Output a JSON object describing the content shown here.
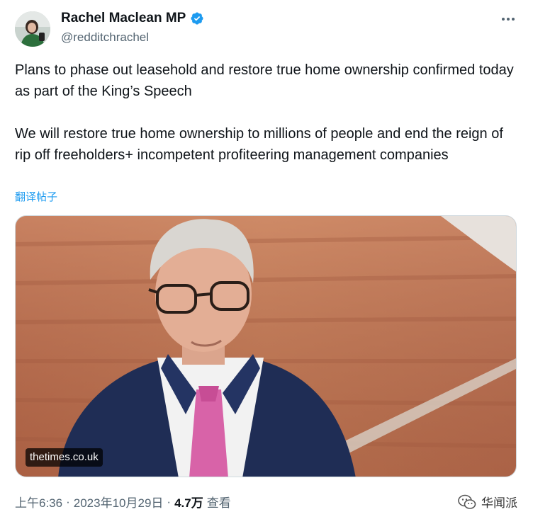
{
  "author": {
    "display_name": "Rachel Maclean MP",
    "handle": "@redditchrachel",
    "verified_icon": "verified-badge-icon",
    "avatar_icon": "profile-avatar"
  },
  "more_icon": "more-options-icon",
  "tweet": {
    "paragraph_1": "Plans to phase out leasehold and restore true home ownership confirmed today as part of the King’s Speech",
    "paragraph_2": "We will restore true home ownership to millions of people and end the reign of rip off freeholders+ incompetent profiteering management companies",
    "translate_label": "翻译帖子"
  },
  "media": {
    "domain_label": "thetimes.co.uk"
  },
  "meta": {
    "time": "上午6:36",
    "date": "2023年10月29日",
    "separator": "·",
    "views_count": "4.7万",
    "views_label": "查看"
  },
  "watermark": {
    "label": "华闻派",
    "icon": "wechat-icon"
  },
  "colors": {
    "link_blue": "#1d9bf0",
    "text_primary": "#0f1419",
    "text_secondary": "#536471",
    "verified_blue": "#1d9bf0"
  }
}
